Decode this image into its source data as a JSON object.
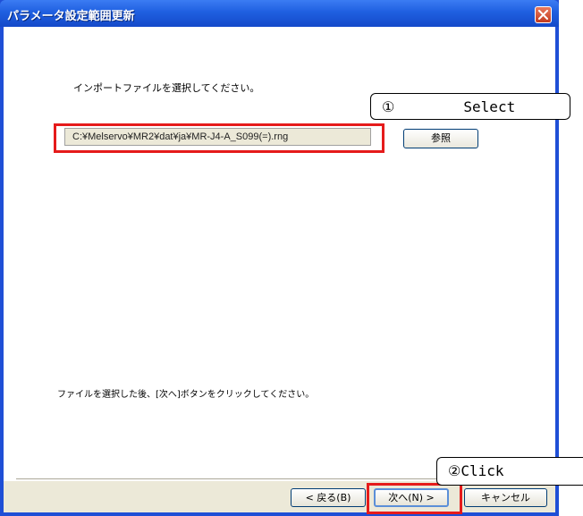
{
  "window": {
    "title": "パラメータ設定範囲更新"
  },
  "main": {
    "prompt": "インポートファイルを選択してください。",
    "file_path": "C:¥Melservo¥MR2¥dat¥ja¥MR-J4-A_S099(=).rng",
    "browse_label": "参照",
    "instruction": "ファイルを選択した後、[次へ]ボタンをクリックしてください。"
  },
  "footer": {
    "back_label": "< 戻る(B)",
    "next_label": "次へ(N) >",
    "cancel_label": "キャンセル"
  },
  "annotations": {
    "callout_1": "①        Select",
    "callout_2": "②Click",
    "highlight_color": "#e51b1b"
  },
  "icons": {
    "close": "close-icon"
  },
  "colors": {
    "titlebar": "#1f5fe0",
    "dialog_face": "#ece9d8",
    "close_button": "#c23b1f"
  }
}
